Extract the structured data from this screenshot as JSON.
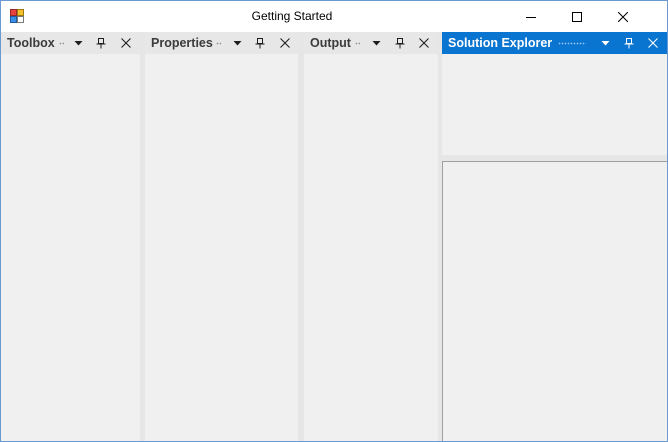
{
  "window": {
    "title": "Getting Started"
  },
  "titlebar_buttons": {
    "minimize_icon": "minimize-icon",
    "maximize_icon": "maximize-icon",
    "close_icon": "close-icon"
  },
  "panes": [
    {
      "id": "toolbox",
      "title": "Toolbox",
      "active": false
    },
    {
      "id": "properties",
      "title": "Properties",
      "active": false
    },
    {
      "id": "output",
      "title": "Output",
      "active": false
    },
    {
      "id": "solution-explorer",
      "title": "Solution Explorer",
      "active": true
    }
  ],
  "colors": {
    "active_header": "#0a74d1",
    "inactive_header": "#e7e7e7",
    "background": "#f0f0f0",
    "window_border": "#6a9ad3"
  }
}
